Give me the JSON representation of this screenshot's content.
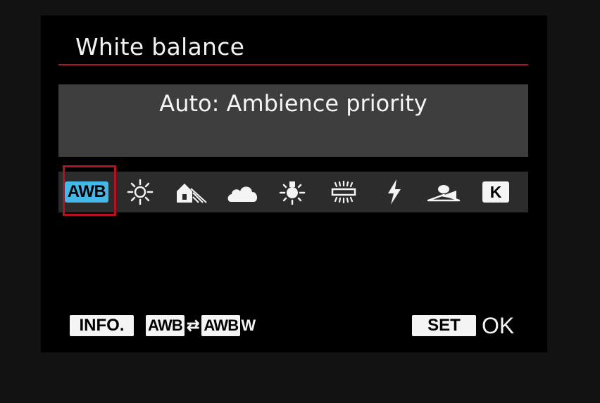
{
  "screen": {
    "title": "White balance",
    "description": "Auto: Ambience priority"
  },
  "wb_options": [
    {
      "name": "auto-white-balance",
      "icon": "awb-icon",
      "label": "AWB",
      "selected": true
    },
    {
      "name": "daylight",
      "icon": "sun-icon"
    },
    {
      "name": "shade",
      "icon": "shade-house-icon"
    },
    {
      "name": "cloudy",
      "icon": "cloud-icon"
    },
    {
      "name": "tungsten",
      "icon": "bulb-icon"
    },
    {
      "name": "fluorescent",
      "icon": "fluorescent-icon"
    },
    {
      "name": "flash",
      "icon": "flash-icon"
    },
    {
      "name": "custom",
      "icon": "custom-wb-icon"
    },
    {
      "name": "color-temperature",
      "icon": "kelvin-icon",
      "label": "K"
    }
  ],
  "footer": {
    "info_label": "INFO.",
    "awb_label": "AWB",
    "swap_symbol": "⇄",
    "awbw_label": "AWB",
    "awbw_suffix": "W",
    "set_label": "SET",
    "ok_label": "OK"
  },
  "colors": {
    "accent_red": "#b3121e",
    "awb_blue": "#45b8e8",
    "panel_gray": "#3e3e3e",
    "strip_gray": "#2c2c2c"
  }
}
